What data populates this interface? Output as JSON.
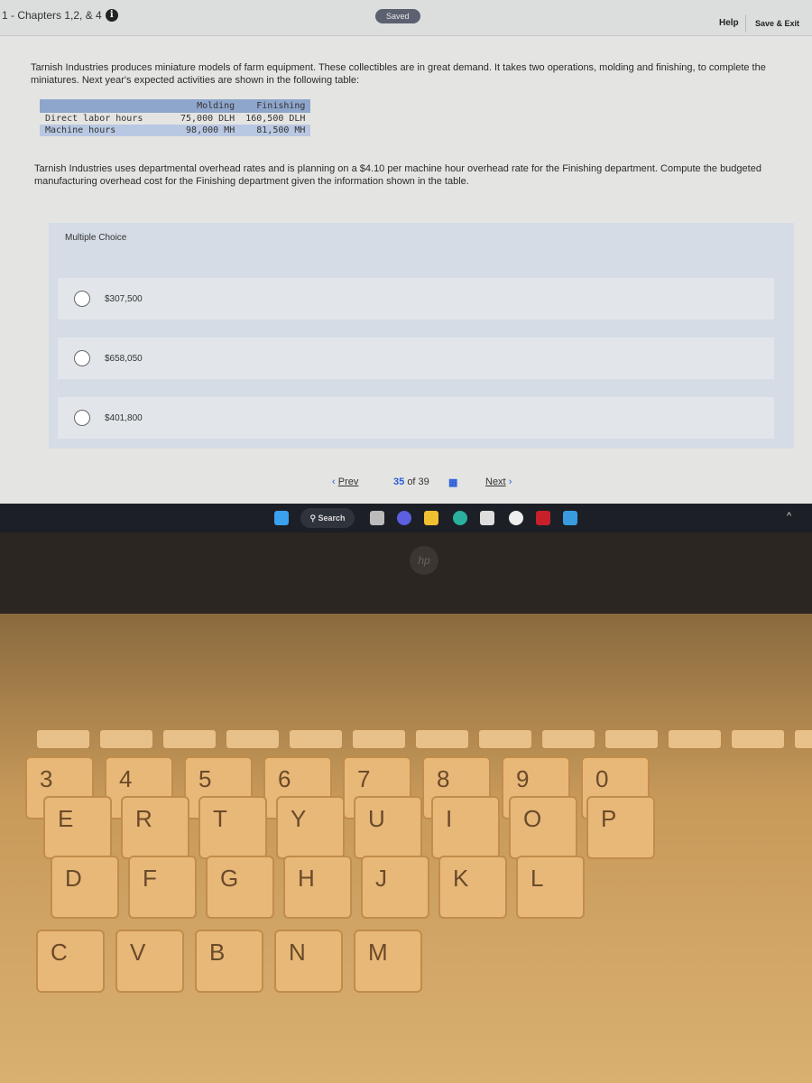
{
  "header": {
    "breadcrumb": "1 - Chapters 1,2, & 4",
    "saved": "Saved",
    "help": "Help",
    "save_exit": "Save & Exit"
  },
  "question": {
    "intro": "Tarnish Industries produces miniature models of farm equipment. These collectibles are in great demand. It takes two operations, molding and finishing, to complete the miniatures. Next year's expected activities are shown in the following table:",
    "table": {
      "headers": [
        "",
        "Molding",
        "Finishing"
      ],
      "rows": [
        [
          "Direct labor hours",
          "75,000 DLH",
          "160,500 DLH"
        ],
        [
          "Machine hours",
          "98,000 MH",
          "81,500 MH"
        ]
      ]
    },
    "prompt": "Tarnish Industries uses departmental overhead rates and is planning on a $4.10 per machine hour overhead rate for the Finishing department. Compute the budgeted manufacturing overhead cost for the Finishing department given the information shown in the table."
  },
  "choices": {
    "title": "Multiple Choice",
    "options": [
      "$307,500",
      "$658,050",
      "$401,800"
    ]
  },
  "nav": {
    "prev": "Prev",
    "current": "35",
    "of": "of 39",
    "next": "Next"
  },
  "taskbar": {
    "search": "Search"
  },
  "laptop": {
    "logo": "hp",
    "keys": [
      "3",
      "4",
      "5",
      "6",
      "7",
      "8",
      "9",
      "0",
      "E",
      "R",
      "T",
      "Y",
      "U",
      "I",
      "O",
      "P",
      "D",
      "F",
      "G",
      "H",
      "J",
      "K",
      "L",
      "C",
      "V",
      "B",
      "N",
      "M"
    ]
  }
}
